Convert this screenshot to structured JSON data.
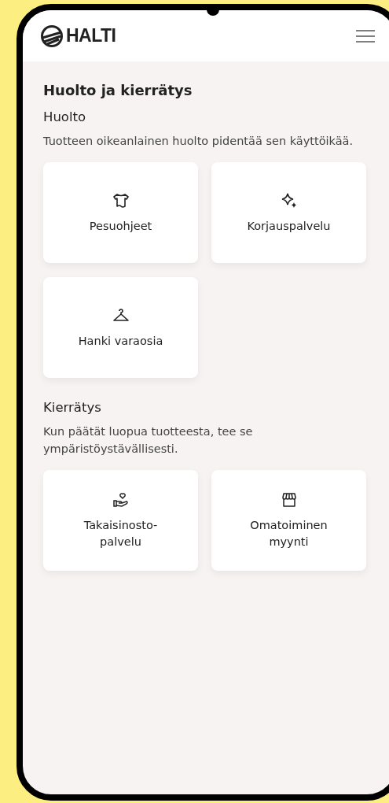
{
  "header": {
    "brand": "HALTI"
  },
  "page_title": "Huolto ja kierrätys",
  "sections": [
    {
      "title": "Huolto",
      "description": "Tuotteen oikeanlainen huolto pidentää sen käyttöikää.",
      "cards": [
        {
          "label": "Pesuohjeet",
          "kind": "shirt"
        },
        {
          "label": "Korjauspalvelu",
          "kind": "sparkle"
        },
        {
          "label": "Hanki varaosia",
          "kind": "hanger"
        }
      ]
    },
    {
      "title": "Kierrätys",
      "description": "Kun päätät luopua tuotteesta, tee se ympäristöystävällisesti.",
      "cards": [
        {
          "label": "Takaisinosto-palvelu",
          "kind": "hand-heart"
        },
        {
          "label": "Omatoiminen myynti",
          "kind": "shop"
        }
      ]
    }
  ]
}
